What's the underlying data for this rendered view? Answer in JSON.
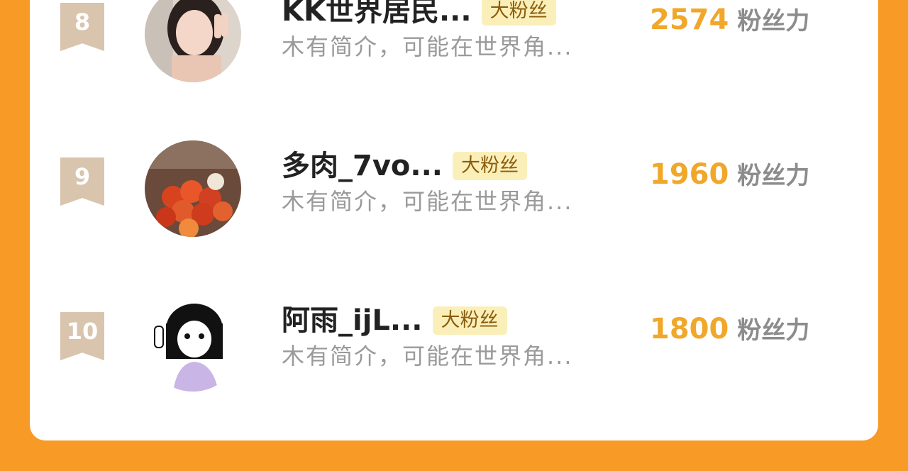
{
  "ranking": {
    "items": [
      {
        "rank": "8",
        "name": "KK世界居民...",
        "badge": "大粉丝",
        "bio": "木有简介，可能在世界角...",
        "score": "2574",
        "score_unit": "粉丝力"
      },
      {
        "rank": "9",
        "name": "多肉_7vo...",
        "badge": "大粉丝",
        "bio": "木有简介，可能在世界角...",
        "score": "1960",
        "score_unit": "粉丝力"
      },
      {
        "rank": "10",
        "name": "阿雨_ijL...",
        "badge": "大粉丝",
        "bio": "木有简介，可能在世界角...",
        "score": "1800",
        "score_unit": "粉丝力"
      }
    ]
  },
  "colors": {
    "page_background": "#f79a26",
    "card": "#ffffff",
    "rank_ribbon": "#d9c4ad",
    "score": "#f0a72a",
    "badge_bg": "#fbefb9"
  },
  "icons": [
    "rank-ribbon-icon",
    "avatar"
  ]
}
